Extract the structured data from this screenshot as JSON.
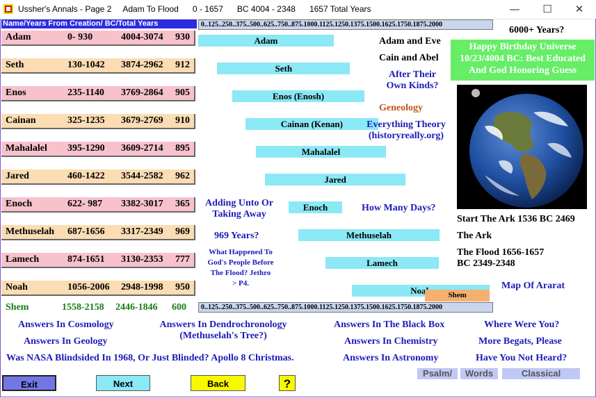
{
  "window": {
    "title": "Ussher's Annals - Page 2     Adam To Flood      0 - 1657      BC 4004 - 2348      1657 Total Years",
    "minimize": "—",
    "maximize": "☐",
    "close": "✕"
  },
  "header": {
    "label": "Name/Years From Creation/ BC/Total Years",
    "scale": "0..125..250..375..500..625..750..875.1000.1125.1250.1375.1500.1625.1750.1875.2000"
  },
  "patriarchs": [
    {
      "name": "Adam",
      "years": "0- 930",
      "bc": "4004-3074",
      "total": "930",
      "bar_label": "Adam",
      "start": 0,
      "end": 930
    },
    {
      "name": "Seth",
      "years": "130-1042",
      "bc": "3874-2962",
      "total": "912",
      "bar_label": "Seth",
      "start": 130,
      "end": 1042
    },
    {
      "name": "Enos",
      "years": "235-1140",
      "bc": "3769-2864",
      "total": "905",
      "bar_label": "Enos (Enosh)",
      "start": 235,
      "end": 1140
    },
    {
      "name": "Cainan",
      "years": "325-1235",
      "bc": "3679-2769",
      "total": "910",
      "bar_label": "Cainan (Kenan)",
      "start": 325,
      "end": 1235
    },
    {
      "name": "Mahalalel",
      "years": "395-1290",
      "bc": "3609-2714",
      "total": "895",
      "bar_label": "Mahalalel",
      "start": 395,
      "end": 1290
    },
    {
      "name": "Jared",
      "years": "460-1422",
      "bc": "3544-2582",
      "total": "962",
      "bar_label": "Jared",
      "start": 460,
      "end": 1422
    },
    {
      "name": "Enoch",
      "years": "622- 987",
      "bc": "3382-3017",
      "total": "365",
      "bar_label": "Enoch",
      "start": 622,
      "end": 987
    },
    {
      "name": "Methuselah",
      "years": "687-1656",
      "bc": "3317-2349",
      "total": "969",
      "bar_label": "Methuselah",
      "start": 687,
      "end": 1656
    },
    {
      "name": "Lamech",
      "years": "874-1651",
      "bc": "3130-2353",
      "total": "777",
      "bar_label": "Lamech",
      "start": 874,
      "end": 1651
    },
    {
      "name": "Noah",
      "years": "1056-2006",
      "bc": "2948-1998",
      "total": "950",
      "bar_label": "Noah",
      "start": 1056,
      "end": 2006
    }
  ],
  "shem": {
    "name": "Shem",
    "years": "1558-2158",
    "bc": "2446-1846",
    "total": "600",
    "bar_label": "Shem",
    "start": 1558,
    "end": 2158
  },
  "timeline": {
    "min": 0,
    "max": 2000
  },
  "middle_links": {
    "adam_eve": "Adam and Eve",
    "cain_abel": "Cain and Abel",
    "after_kinds_1": "After Their",
    "after_kinds_2": "Own Kinds?",
    "geneology": "Geneology",
    "everything_1": "Everything Theory",
    "everything_2": "(historyreally.org)",
    "adding_1": "Adding Unto Or",
    "adding_2": "Taking Away",
    "how_many_days": "How Many Days?",
    "969_years": "969 Years?",
    "what_happened_1": "What Happened To",
    "what_happened_2": "God's People Before",
    "what_happened_3": "The Flood?   Jethro",
    "what_happened_4": "> P4."
  },
  "right_panel": {
    "years_6000": "6000+ Years?",
    "birthday_1": "Happy Birthday Universe",
    "birthday_2": "10/23/4004 BC: Best Educated",
    "birthday_3": "And God Honoring Guess",
    "start_ark": "Start The Ark 1536 BC 2469",
    "the_ark": "The Ark",
    "flood_1": "The Flood 1656-1657",
    "flood_2": "BC 2349-2348",
    "map_ararat": "Map Of Ararat"
  },
  "bottom_links": {
    "cosmology": "Answers In Cosmology",
    "dendro_1": "Answers In  Dendrochronology",
    "dendro_2": "(Methuselah's Tree?)",
    "black_box": "Answers In The Black Box",
    "where_were_you": "Where Were You?",
    "geology": "Answers In Geology",
    "chemistry": "Answers In Chemistry",
    "more_begats": "More Begats, Please",
    "nasa": "Was NASA Blindsided In 1968, Or Just Blinded? Apollo 8 Christmas.",
    "astronomy": "Answers In Astronomy",
    "not_heard": "Have You Not Heard?"
  },
  "buttons": {
    "exit": "Exit",
    "next": "Next",
    "back": "Back",
    "help": "?",
    "psalm": "Psalm/",
    "words": "Words",
    "classical": "Classical"
  },
  "colors": {
    "bar": "#8be8f5",
    "shem_bar": "#f5b070",
    "link_blue": "#1c1cb8",
    "geneology": "#c0501a",
    "birthday_bg": "#66ee66"
  }
}
